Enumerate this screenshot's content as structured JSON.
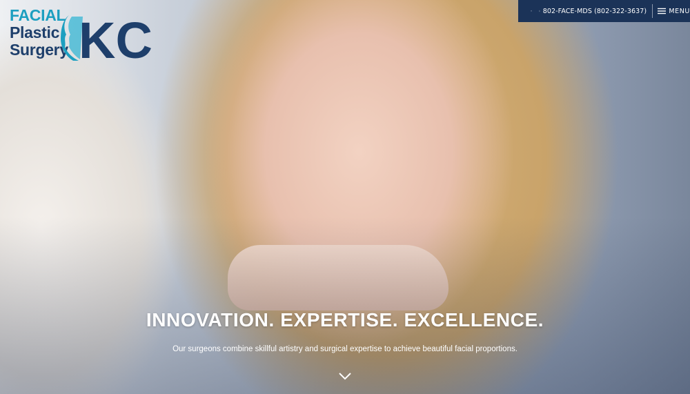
{
  "logo": {
    "line1": "FACIAL",
    "line2": "Plastic",
    "line3": "Surgery",
    "mark": "KC"
  },
  "topbar": {
    "location_icon": "map-pin-icon",
    "phone_icon": "mobile-phone-icon",
    "phone": "802-FACE-MDS (802-322-3637)",
    "menu_icon": "hamburger-icon",
    "menu_label": "MENU"
  },
  "hero": {
    "headline": "INNOVATION. EXPERTISE. EXCELLENCE.",
    "subline": "Our surgeons combine skillful artistry and surgical expertise to achieve beautiful facial proportions.",
    "scroll_icon": "chevron-down-icon"
  },
  "colors": {
    "brand_navy": "#1e3f6b",
    "brand_teal": "#1d9fc0",
    "topbar_bg": "#1b3358"
  }
}
